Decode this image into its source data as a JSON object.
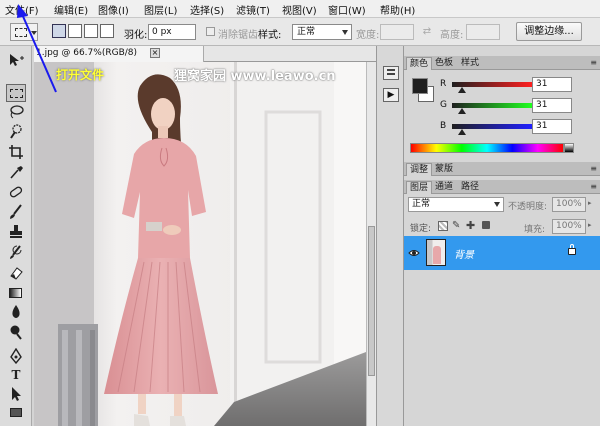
{
  "menu": [
    "文件(F)",
    "编辑(E)",
    "图像(I)",
    "图层(L)",
    "选择(S)",
    "滤镜(T)",
    "视图(V)",
    "窗口(W)",
    "帮助(H)"
  ],
  "options": {
    "feather_label": "羽化:",
    "feather_value": "0 px",
    "anti_alias_label": "消除锯齿",
    "style_label": "样式:",
    "style_value": "正常",
    "width_label": "宽度:",
    "height_label": "高度:",
    "refine_edge_button": "调整边缘..."
  },
  "annotation": "打开文件",
  "document": {
    "tab_title": "1.jpg @ 66.7%(RGB/8)",
    "tab_close": "×",
    "watermark": "狸窝家园 www.leawo.cn"
  },
  "color_panel": {
    "tabs": [
      "颜色",
      "色板",
      "样式"
    ],
    "channels": [
      {
        "label": "R",
        "value": "31",
        "fraction": 0.12
      },
      {
        "label": "G",
        "value": "31",
        "fraction": 0.12
      },
      {
        "label": "B",
        "value": "31",
        "fraction": 0.12
      }
    ],
    "foreground_color": "#1f1f1f",
    "background_color": "#ffffff"
  },
  "adjust_panel": {
    "tabs": [
      "调整",
      "蒙版"
    ]
  },
  "layers_panel": {
    "tabs": [
      "图层",
      "通道",
      "路径"
    ],
    "blend_mode": "正常",
    "opacity_label": "不透明度:",
    "opacity_value": "100%",
    "lock_label": "锁定:",
    "fill_label": "填充:",
    "fill_value": "100%",
    "layers": [
      {
        "name": "背景",
        "selected": true,
        "locked": true
      }
    ]
  },
  "colors": {
    "accent": "#3399ee",
    "annotation": "#1a1aee",
    "annotation_text": "#ffff33"
  }
}
